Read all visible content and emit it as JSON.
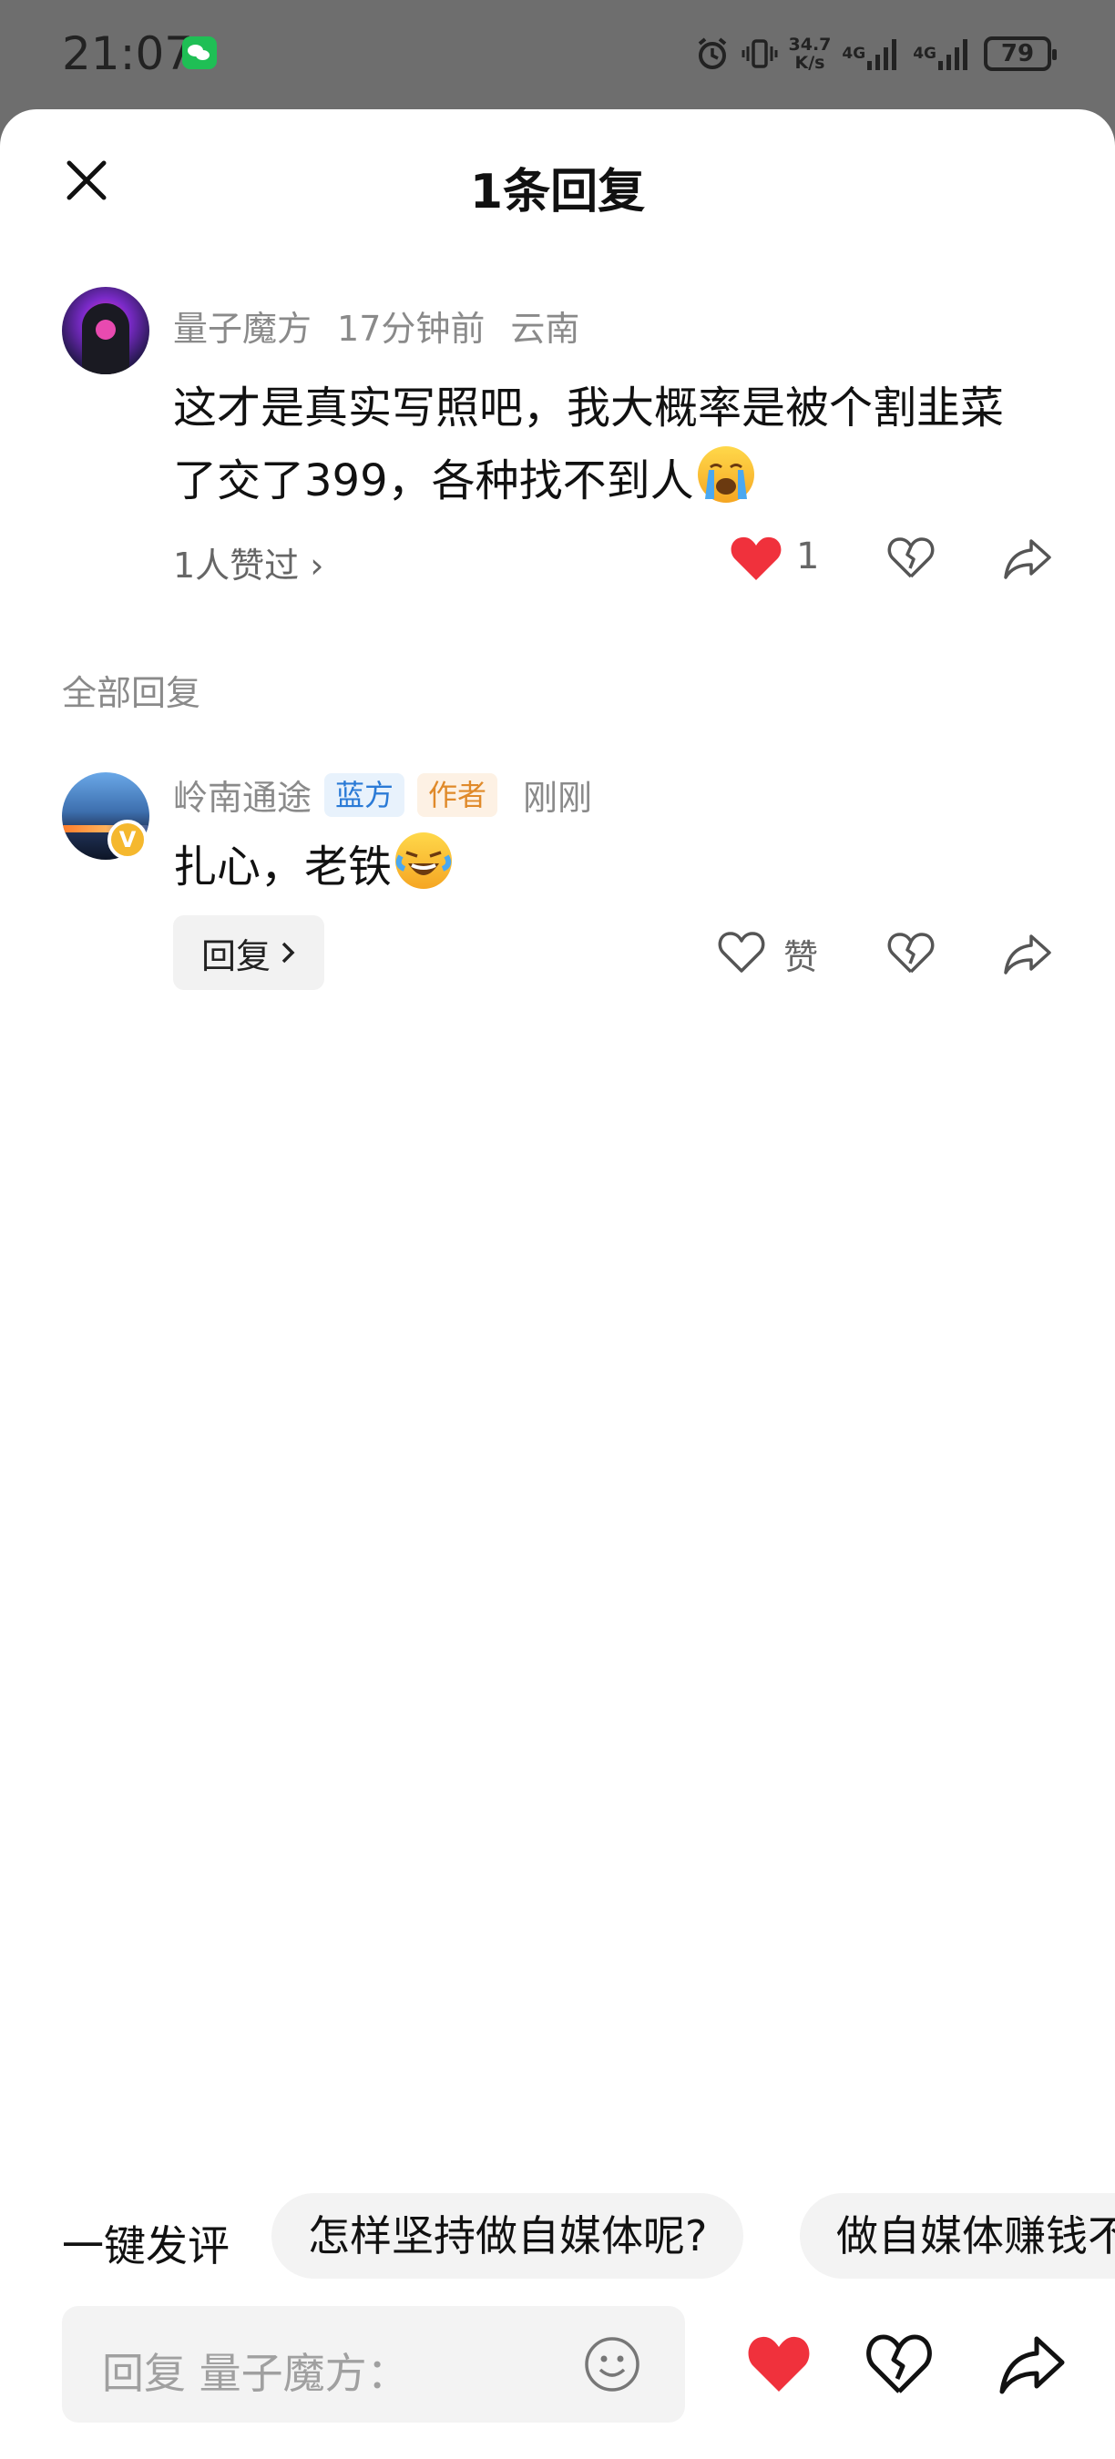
{
  "status_bar": {
    "time": "21:07",
    "network_speed_value": "34.7",
    "network_speed_unit": "K/s",
    "net_type_1": "4G",
    "net_type_2": "4G",
    "battery": "79",
    "icons": [
      "wechat-icon",
      "alarm-icon",
      "vibrate-icon",
      "signal-icon",
      "battery-icon"
    ]
  },
  "sheet": {
    "title": "1条回复",
    "close_icon": "close-icon"
  },
  "main_comment": {
    "username": "量子魔方",
    "time": "17分钟前",
    "location": "云南",
    "text": "这才是真实写照吧，我大概率是被个割韭菜了交了399，各种找不到人",
    "emoji": "crying-face-emoji",
    "likes_link": "1人赞过 ›",
    "like_count": "1",
    "liked": true
  },
  "replies_section": {
    "label": "全部回复"
  },
  "reply": {
    "username": "岭南通途",
    "tag_1": "蓝方",
    "tag_2": "作者",
    "time": "刚刚",
    "verified_badge": "V",
    "text": "扎心，老铁",
    "emoji": "rolling-laughing-emoji",
    "reply_button": "回复",
    "like_label": "赞"
  },
  "quick_comment": {
    "label": "一键发评",
    "chips": [
      "怎样坚持做自媒体呢?",
      "做自媒体赚钱不"
    ]
  },
  "input_bar": {
    "placeholder": "回复 量子魔方："
  },
  "colors": {
    "like_red": "#f0313c",
    "tag_blue_text": "#2a7ad6",
    "tag_orange_text": "#e08a2a",
    "verified_gold": "#f5b82e"
  }
}
